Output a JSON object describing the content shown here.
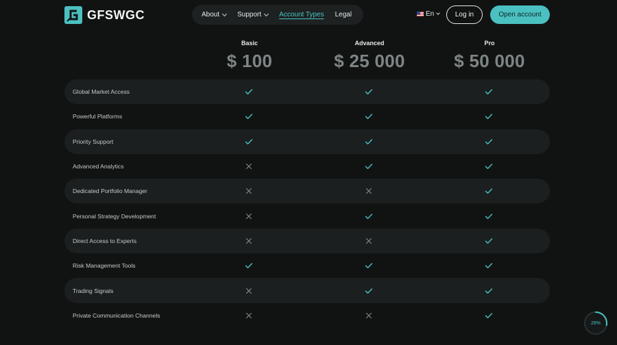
{
  "brand": {
    "name": "GFSWGC",
    "accent": "#4bc0c1"
  },
  "nav": {
    "items": [
      {
        "label": "About",
        "has_dropdown": true,
        "active": false
      },
      {
        "label": "Support",
        "has_dropdown": true,
        "active": false
      },
      {
        "label": "Account Types",
        "has_dropdown": false,
        "active": true
      },
      {
        "label": "Legal",
        "has_dropdown": false,
        "active": false
      }
    ],
    "language": "En",
    "login_label": "Log in",
    "open_account_label": "Open account"
  },
  "plans": [
    {
      "name": "Basic",
      "price": "$ 100"
    },
    {
      "name": "Advanced",
      "price": "$ 25 000"
    },
    {
      "name": "Pro",
      "price": "$ 50 000"
    }
  ],
  "features": [
    {
      "label": "Global Market Access",
      "included": [
        true,
        true,
        true
      ]
    },
    {
      "label": "Powerful Platforms",
      "included": [
        true,
        true,
        true
      ]
    },
    {
      "label": "Priority Support",
      "included": [
        true,
        true,
        true
      ]
    },
    {
      "label": "Advanced Analytics",
      "included": [
        false,
        true,
        true
      ]
    },
    {
      "label": "Dedicated Portfolio Manager",
      "included": [
        false,
        false,
        true
      ]
    },
    {
      "label": "Personal Strategy Development",
      "included": [
        false,
        true,
        true
      ]
    },
    {
      "label": "Direct Access to Experts",
      "included": [
        false,
        false,
        true
      ]
    },
    {
      "label": "Risk Management Tools",
      "included": [
        true,
        true,
        true
      ]
    },
    {
      "label": "Trading Signals",
      "included": [
        false,
        true,
        true
      ]
    },
    {
      "label": "Private Communication Channels",
      "included": [
        false,
        false,
        true
      ]
    }
  ],
  "scroll_progress": {
    "label": "28%",
    "value": 0.28
  }
}
